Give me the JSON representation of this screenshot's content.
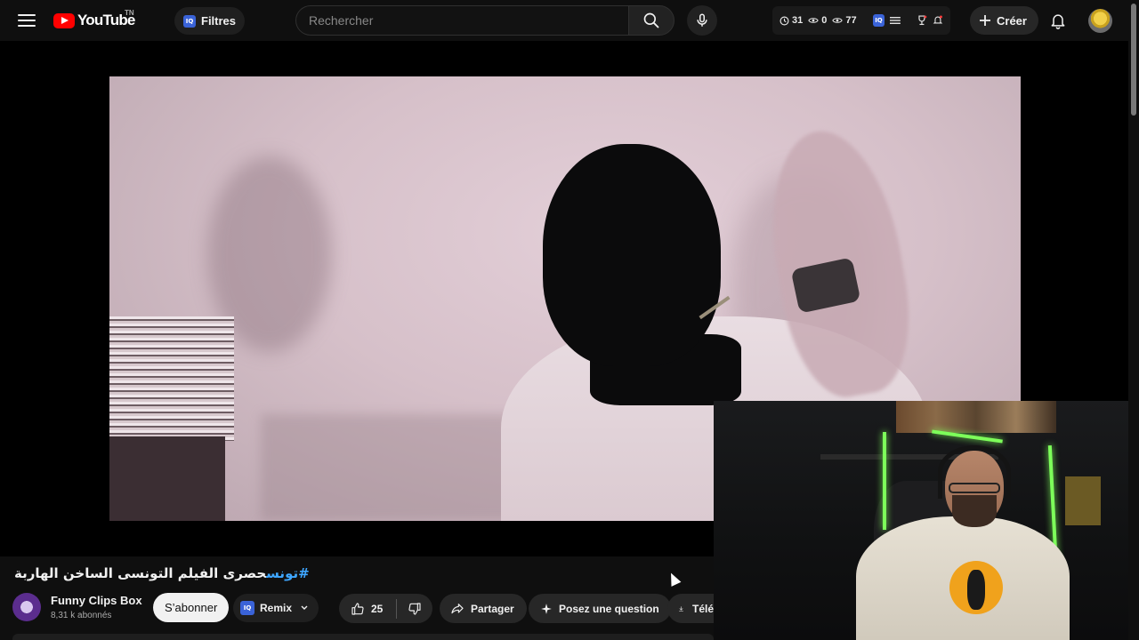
{
  "header": {
    "logo_text": "YouTube",
    "country_code": "TN",
    "filters_label": "Filtres",
    "iq_badge": "IQ",
    "search_placeholder": "Rechercher",
    "extension": {
      "watch_later_count": "31",
      "views_a": "0",
      "views_b": "77"
    },
    "create_label": "Créer"
  },
  "video": {
    "title_hashtag": "#تونس",
    "title_text": "حصرى الفيلم التونسى الساخن الهاربة"
  },
  "channel": {
    "name": "Funny Clips Box",
    "subscribers": "8,31 k abonnés",
    "subscribe_label": "S’abonner"
  },
  "actions": {
    "remix_label": "Remix",
    "like_count": "25",
    "share_label": "Partager",
    "ask_label": "Posez une question",
    "download_label": "Télé"
  },
  "icons": {
    "menu": "menu-icon",
    "search": "search-icon",
    "mic": "mic-icon",
    "bell": "bell-icon",
    "like": "thumbs-up-icon",
    "dislike": "thumbs-down-icon",
    "share": "share-icon",
    "ask": "sparkle-icon",
    "download": "download-icon"
  },
  "colors": {
    "background": "#0f0f0f",
    "brand_red": "#ff0000",
    "hashtag_blue": "#3ea6ff",
    "button_bg": "#272727",
    "subscribe_bg": "#f1f1f1"
  }
}
